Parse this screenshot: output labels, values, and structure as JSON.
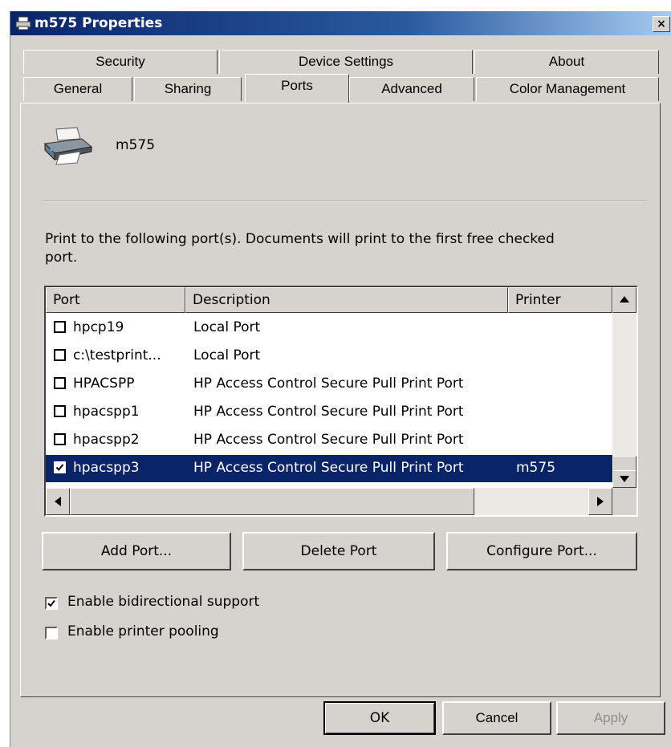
{
  "window": {
    "title": "m575 Properties",
    "close_label": "×"
  },
  "tabs": {
    "row1": [
      "Security",
      "Device Settings",
      "About"
    ],
    "row2": [
      "General",
      "Sharing",
      "Ports",
      "Advanced",
      "Color Management"
    ],
    "active": "Ports"
  },
  "printer": {
    "name": "m575",
    "icon": "printer-icon"
  },
  "instructions": "Print to the following port(s). Documents will print to the first free checked port.",
  "port_list": {
    "columns": [
      "Port",
      "Description",
      "Printer"
    ],
    "rows": [
      {
        "checked": false,
        "port": "hpcp19",
        "description": "Local Port",
        "printer": ""
      },
      {
        "checked": false,
        "port": "c:\\testprint...",
        "description": "Local Port",
        "printer": ""
      },
      {
        "checked": false,
        "port": "HPACSPP",
        "description": "HP Access Control Secure Pull Print Port",
        "printer": ""
      },
      {
        "checked": false,
        "port": "hpacspp1",
        "description": "HP Access Control Secure Pull Print Port",
        "printer": ""
      },
      {
        "checked": false,
        "port": "hpacspp2",
        "description": "HP Access Control Secure Pull Print Port",
        "printer": ""
      },
      {
        "checked": true,
        "port": "hpacspp3",
        "description": "HP Access Control Secure Pull Print Port",
        "printer": "m575",
        "selected": true
      }
    ]
  },
  "port_buttons": {
    "add": "Add Port...",
    "delete": "Delete Port",
    "configure": "Configure Port..."
  },
  "options": {
    "bidirectional": {
      "label": "Enable bidirectional support",
      "checked": true
    },
    "pooling": {
      "label": "Enable printer pooling",
      "checked": false
    }
  },
  "dialog_buttons": {
    "ok": "OK",
    "cancel": "Cancel",
    "apply": "Apply"
  },
  "colors": {
    "titlebar": "#0a246a",
    "selection": "#0a246a",
    "face": "#d6d3ce"
  }
}
